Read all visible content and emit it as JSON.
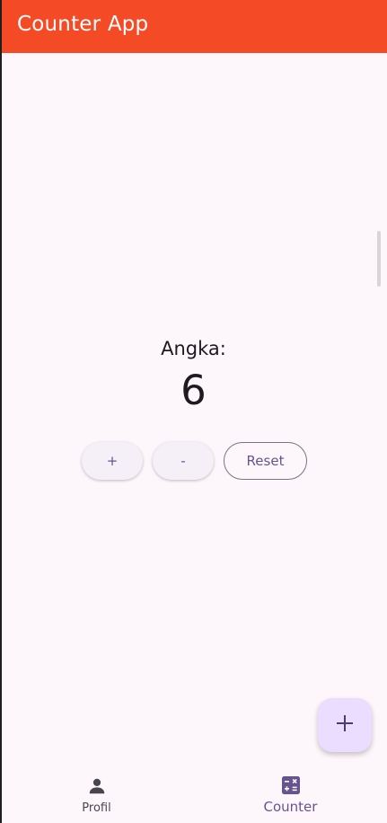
{
  "app_bar": {
    "title": "Counter App",
    "color": "#f44a25"
  },
  "counter": {
    "label": "Angka:",
    "value": "6"
  },
  "buttons": {
    "increment_label": "+",
    "decrement_label": "-",
    "reset_label": "Reset"
  },
  "fab": {
    "icon": "plus-icon"
  },
  "bottom_nav": {
    "items": [
      {
        "label": "Profil",
        "icon": "person-icon",
        "selected": false
      },
      {
        "label": "Counter",
        "icon": "calculator-icon",
        "selected": true
      }
    ]
  },
  "colors": {
    "background": "#fdf7fc",
    "accent": "#65558f",
    "fab_background": "#eaddff"
  }
}
